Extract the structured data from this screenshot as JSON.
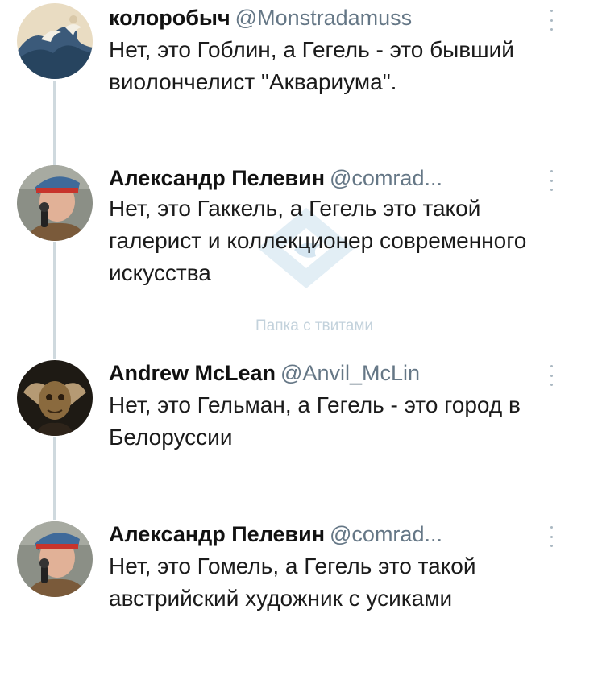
{
  "tweets": [
    {
      "name": "колоробыч",
      "handle": "@Monstradamuss",
      "text": "Нет, это Гоблин, а Гегель - это бывший виолончелист \"Аквариума\".",
      "avatar_icon": "great-wave-avatar"
    },
    {
      "name": "Александр Пелевин",
      "handle": "@comrad...",
      "text": "Нет, это Гаккель, а Гегель это такой галерист и коллекционер современного искусства",
      "avatar_icon": "soldier-microphone-avatar"
    },
    {
      "name": "Andrew McLean",
      "handle": "@Anvil_McLin",
      "text": "Нет, это Гельман, а Гегель - это город в Белоруссии",
      "avatar_icon": "owl-figure-avatar"
    },
    {
      "name": "Александр Пелевин",
      "handle": "@comrad...",
      "text": "Нет, это Гомель, а Гегель это такой австрийский художник с усиками",
      "avatar_icon": "soldier-microphone-avatar"
    }
  ],
  "watermark": {
    "text": "Папка с твитами",
    "icon": "folder-bird-watermark-icon"
  },
  "colors": {
    "handle": "#657786",
    "thread_line": "#cfd9de",
    "menu_dots": "#aab8c2"
  }
}
